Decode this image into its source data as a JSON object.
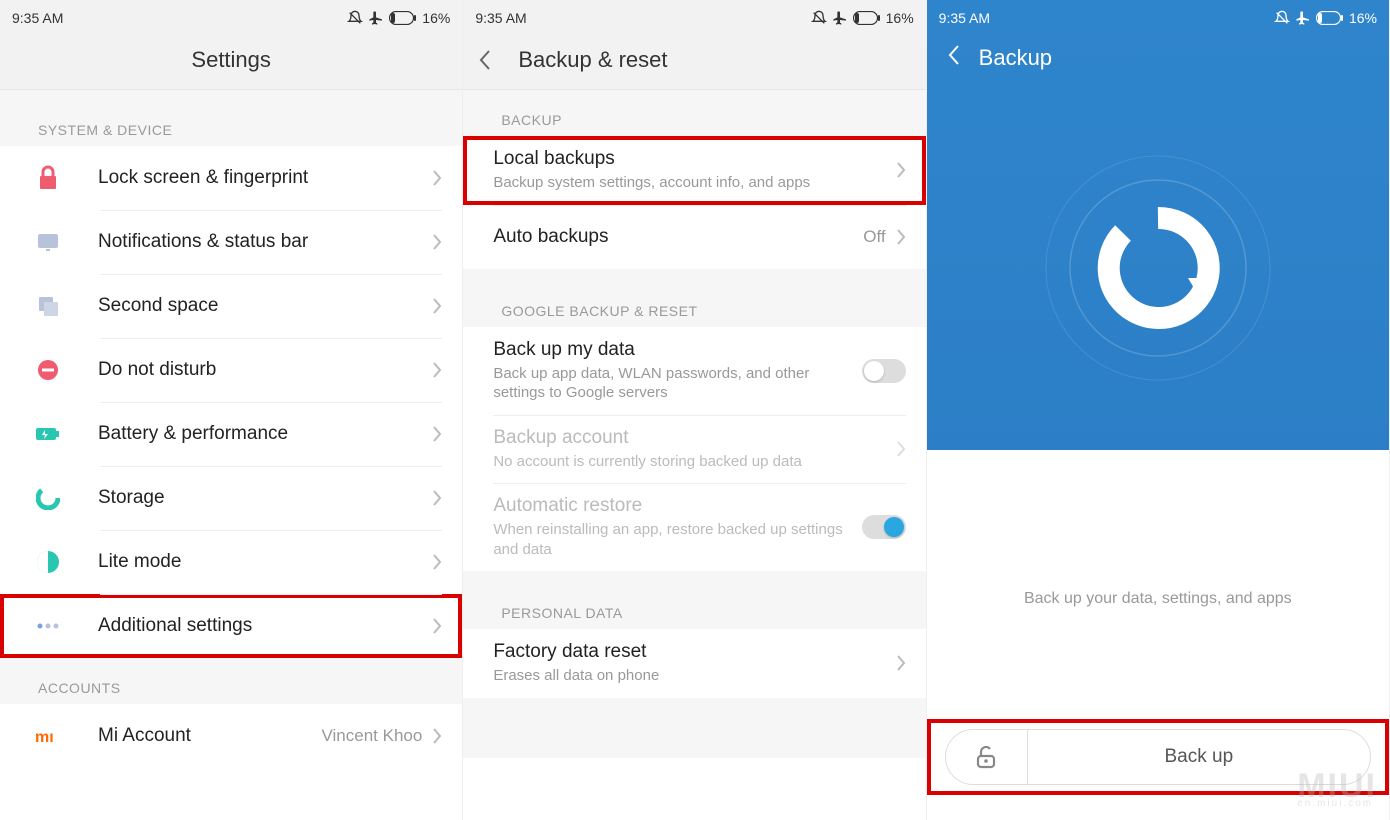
{
  "status": {
    "time": "9:35 AM",
    "battery_pct": "16%"
  },
  "panel1": {
    "title": "Settings",
    "section_system": "SYSTEM & DEVICE",
    "section_accounts": "ACCOUNTS",
    "items": {
      "lock": "Lock screen & fingerprint",
      "notif": "Notifications & status bar",
      "second": "Second space",
      "dnd": "Do not disturb",
      "battery": "Battery & performance",
      "storage": "Storage",
      "lite": "Lite mode",
      "additional": "Additional settings",
      "miaccount": "Mi Account",
      "miaccount_value": "Vincent Khoo"
    }
  },
  "panel2": {
    "title": "Backup & reset",
    "section_backup": "BACKUP",
    "section_google": "GOOGLE BACKUP & RESET",
    "section_personal": "PERSONAL DATA",
    "local_title": "Local backups",
    "local_sub": "Backup system settings, account info, and apps",
    "auto_title": "Auto backups",
    "auto_value": "Off",
    "backup_my_data_title": "Back up my data",
    "backup_my_data_sub": "Back up app data, WLAN passwords, and other settings to Google servers",
    "backup_account_title": "Backup account",
    "backup_account_sub": "No account is currently storing backed up data",
    "auto_restore_title": "Automatic restore",
    "auto_restore_sub": "When reinstalling an app, restore backed up settings and data",
    "factory_title": "Factory data reset",
    "factory_sub": "Erases all data on phone"
  },
  "panel3": {
    "title": "Backup",
    "message": "Back up your data, settings, and apps",
    "button": "Back up"
  },
  "watermark": {
    "big": "MIUI",
    "small": "en.miui.com"
  }
}
